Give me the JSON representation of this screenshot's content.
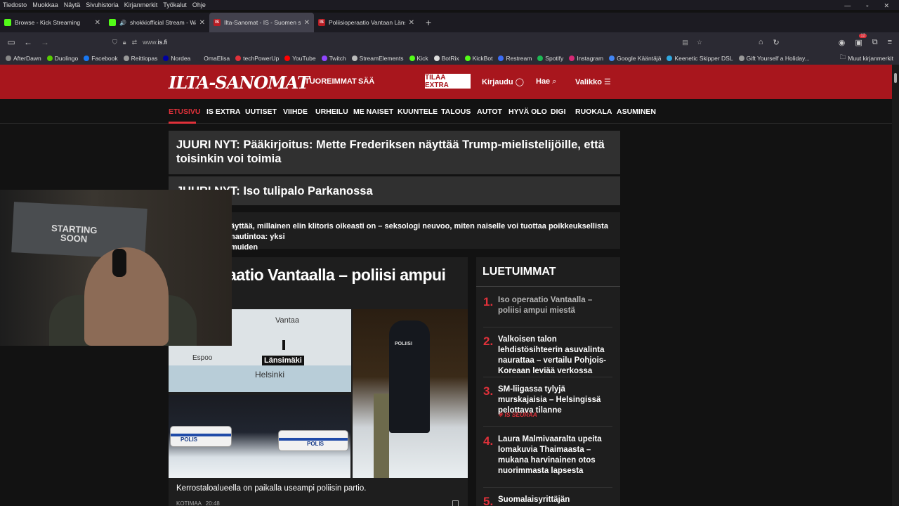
{
  "browser": {
    "menu": [
      "Tiedosto",
      "Muokkaa",
      "Näytä",
      "Sivuhistoria",
      "Kirjanmerkit",
      "Työkalut",
      "Ohje"
    ],
    "window_controls": [
      "—",
      "▫",
      "✕"
    ],
    "tabs": [
      {
        "title": "Browse - Kick Streaming",
        "icon": "kick"
      },
      {
        "title": "shokkiofficial Stream - Wat",
        "icon": "kick"
      },
      {
        "title": "Ilta-Sanomat - IS - Suomen suu",
        "icon": "is"
      },
      {
        "title": "Poliisioperaatio Vantaan Länsim",
        "icon": "is"
      }
    ],
    "close_symbol": "✕",
    "new_tab": "+",
    "url_prefix": "www.",
    "url_domain": "is.fi",
    "badge_count": "12",
    "bookmarks": [
      "AfterDawn",
      "Duolingo",
      "Facebook",
      "Reittiopas",
      "Nordea",
      "OmaElisa",
      "techPowerUp",
      "YouTube",
      "Twitch",
      "StreamElements",
      "Kick",
      "BotRix",
      "KickBot",
      "Restream",
      "Spotify",
      "Instagram",
      "Google Kääntäjä",
      "Keenetic Skipper DSL",
      "Gift Yourself a Holiday..."
    ],
    "bookmarks_other": "Muut kirjanmerkit"
  },
  "site": {
    "logo": "ILTA-SANOMAT",
    "nav": {
      "tuoreimmat": "TUOREIMMAT",
      "saa": "SÄÄ",
      "tilaa": "TILAA EXTRA",
      "kirjaudu": "Kirjaudu",
      "hae": "Hae",
      "valikko": "Valikko"
    },
    "categories": [
      "ETUSIVU",
      "IS EXTRA",
      "UUTISET",
      "VIIHDE",
      "URHEILU",
      "ME NAISET",
      "KUUNTELE",
      "TALOUS",
      "AUTOT",
      "HYVÄ OLO",
      "DIGI",
      "RUOKALA",
      "ASUMINEN"
    ],
    "juuri1": "JUURI NYT: Pääkirjoitus: Mette Frederiksen näyttää Trump-mielistelijöille, että toisinkin voi toimia",
    "juuri2": "JUURI NYT: Iso tulipalo Parkanossa",
    "story3_line1": "äyttää, millainen elin klitoris oikeasti on – seksologi neuvoo, miten naiselle voi tuottaa poikkeuksellista nautintoa: yksi",
    "story3_line2": "muiden",
    "main_headline": "aatio Vantaalla – poliisi ampui",
    "map_labels": {
      "vantaa": "Vantaa",
      "espoo": "Espoo",
      "lansimaki": "Länsimäki",
      "helsinki": "Helsinki"
    },
    "police_label": "POLIS",
    "police_vest": "POLIISI",
    "caption": "Kerrostaloalueella on paikalla useampi poliisin partio.",
    "meta_section": "KOTIMAA",
    "meta_time": "20:48",
    "luetuimmat": {
      "title": "LUETUIMMAT",
      "items": [
        {
          "n": "1.",
          "text": "Iso operaatio Vantaalla – poliisi ampui miestä"
        },
        {
          "n": "2.",
          "text": "Valkoisen talon lehdistösihteerin asuvalinta naurattaa – vertailu Pohjois-Koreaan leviää verkossa"
        },
        {
          "n": "3.",
          "text": "SM-liigassa tylyjä murskajaisia – Helsingissä pelottava tilanne",
          "tag": "IS SEURAA"
        },
        {
          "n": "4.",
          "text": "Laura Malmivaaralta upeita lomakuvia Thaimaasta – mukana harvinainen otos nuorimmasta lapsesta"
        },
        {
          "n": "5.",
          "text": "Suomalaisyrittäjän ihmekeksintö"
        }
      ]
    }
  },
  "webcam": {
    "poster_line1": "STARTING",
    "poster_line2": "SOON"
  }
}
